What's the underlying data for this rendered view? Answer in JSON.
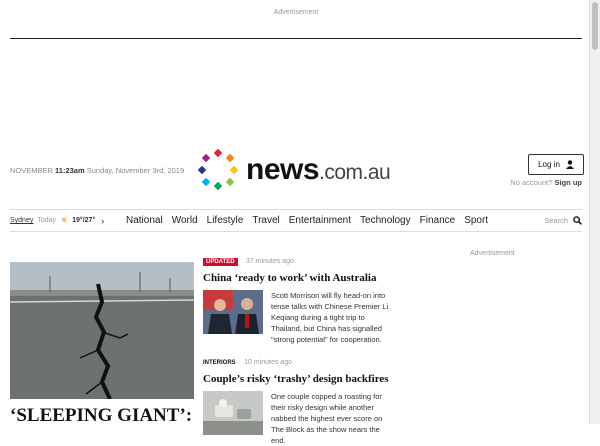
{
  "ad": {
    "label": "Advertisement"
  },
  "masthead": {
    "date_prefix": "NOVEMBER",
    "time": "11:23am",
    "date": "Sunday, November 3rd, 2019",
    "logo_main": "news",
    "logo_domain": ".com.au"
  },
  "account": {
    "login_label": "Log in",
    "no_account": "No account?",
    "signup": "Sign up"
  },
  "weather": {
    "city": "Sydney",
    "day": "Today",
    "temps": "19°/27°"
  },
  "nav": {
    "links": [
      "National",
      "World",
      "Lifestyle",
      "Travel",
      "Entertainment",
      "Technology",
      "Finance",
      "Sport"
    ],
    "search_label": "Search"
  },
  "hero": {
    "headline": "‘SLEEPING GIANT’:"
  },
  "stories": [
    {
      "badge": "UPDATED",
      "time": "37 minutes ago",
      "headline": "China ‘ready to work’ with Australia",
      "summary": "Scott Morrison will fly head-on into tense talks with Chinese Premier Li Keqiang during a tight trip to Thailand, but China has signalled \"strong potential\" for cooperation."
    },
    {
      "kicker": "INTERIORS",
      "time": "10 minutes ago",
      "headline": "Couple’s risky ‘trashy’ design backfires",
      "summary": "One couple copped a roasting for their risky design while another nabbed the highest ever score on The Block as the show nears the end."
    }
  ],
  "right": {
    "ad_label": "Advertisement"
  },
  "colors": {
    "accent_red": "#c8102e"
  }
}
